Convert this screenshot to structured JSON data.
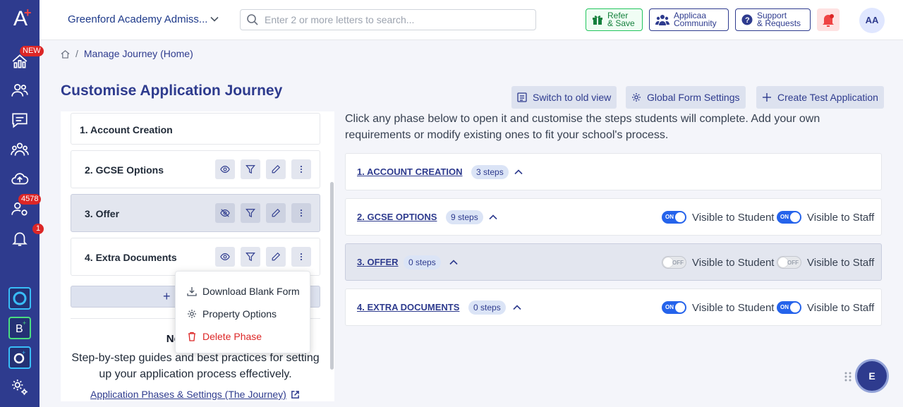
{
  "topbar": {
    "school": "Greenford Academy Admiss...",
    "search_placeholder": "Enter 2 or more letters to search...",
    "refer": [
      "Refer",
      "& Save"
    ],
    "community": [
      "Applicaa",
      "Community"
    ],
    "support": [
      "Support",
      "& Requests"
    ],
    "avatar": "AA"
  },
  "sidebar": {
    "badges": {
      "new": "NEW",
      "count": "4578",
      "notifications": "1"
    }
  },
  "breadcrumb": {
    "home_icon": "home-icon",
    "current": "Manage Journey (Home)"
  },
  "page": {
    "title": "Customise Application Journey",
    "actions": [
      "Switch to old view",
      "Global Form Settings",
      "Create Test Application"
    ],
    "intro": "Click any phase below to open it and customise the steps students will complete. Add your own requirements or modify existing ones to fit your school's process."
  },
  "phases_list": [
    {
      "name": "1. Account Creation"
    },
    {
      "name": "2. GCSE Options"
    },
    {
      "name": "3. Offer"
    },
    {
      "name": "4. Extra Documents"
    }
  ],
  "add_phase": "+",
  "menu": {
    "items": [
      "Download Blank Form",
      "Property Options",
      "Delete Phase"
    ]
  },
  "help": {
    "title": "Need Help?",
    "text": "Step-by-step guides and best practices for setting up your application process effectively.",
    "link": "Application Phases & Settings (The Journey)"
  },
  "phase_cards": [
    {
      "title": "1. ACCOUNT CREATION",
      "steps": "3 steps"
    },
    {
      "title": "2. GCSE OPTIONS",
      "steps": "9 steps",
      "student": "ON",
      "staff": "ON"
    },
    {
      "title": "3. OFFER",
      "steps": "0 steps",
      "student": "OFF",
      "staff": "OFF"
    },
    {
      "title": "4. EXTRA DOCUMENTS",
      "steps": "0 steps",
      "student": "ON",
      "staff": "ON"
    }
  ],
  "visibility_labels": {
    "student": "Visible to Student",
    "staff": "Visible to Staff"
  },
  "fab": "E",
  "colors": {
    "brand": "#2e3b8e",
    "toggle_on": "#2563eb",
    "danger": "#dc2626",
    "green": "#15803d"
  }
}
